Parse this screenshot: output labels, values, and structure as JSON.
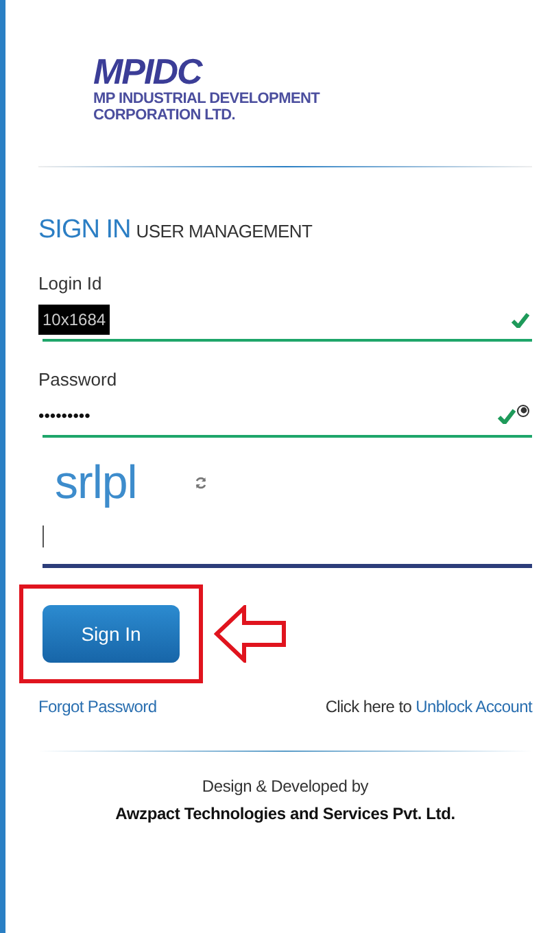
{
  "logo": {
    "mark": "MPIDC",
    "line_1": "MP INDUSTRIAL DEVELOPMENT",
    "line_2": "CORPORATION LTD."
  },
  "heading": {
    "title": "SIGN IN",
    "subtitle": "USER MANAGEMENT"
  },
  "fields": [
    {
      "kind": "text",
      "label": "Login Id",
      "value": "10x1684",
      "redacted": true,
      "valid": true
    },
    {
      "kind": "password",
      "label": "Password",
      "value": "•••••••••",
      "redacted": false,
      "valid": true
    }
  ],
  "captcha": {
    "code": "srlpl"
  },
  "sign_in_button": {
    "label": "Sign In",
    "highlighted": true
  },
  "links": {
    "forgot": "Forgot Password",
    "unblock_prefix": "Click here to",
    "unblock": "Unblock Account"
  },
  "footer": {
    "line_1": "Design & Developed by",
    "line_2": "Awzpact Technologies and Services Pvt. Ltd."
  }
}
